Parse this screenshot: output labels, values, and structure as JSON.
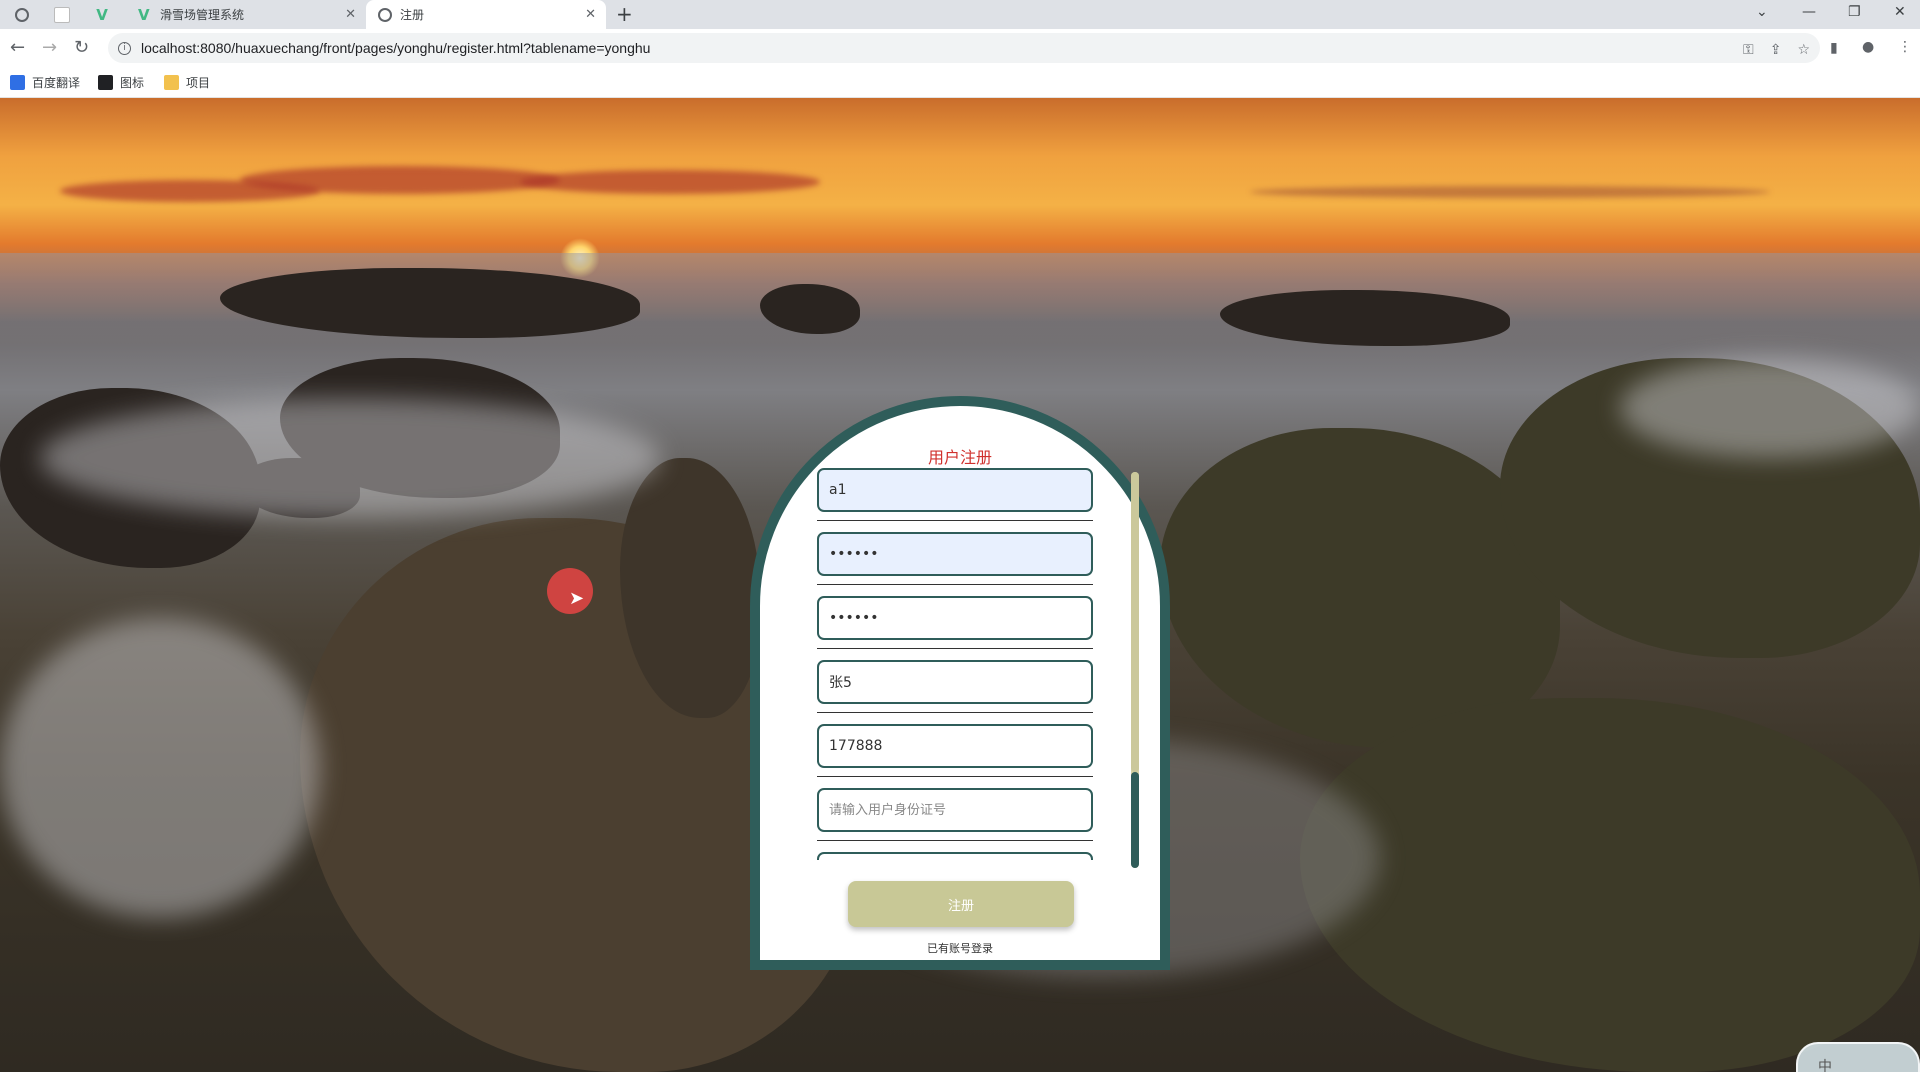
{
  "browser": {
    "tabs": [
      {
        "label": "",
        "icon": "globe-icon"
      },
      {
        "label": "",
        "icon": "blank-page-icon"
      },
      {
        "label": "",
        "icon": "vue-logo-icon"
      },
      {
        "label": "滑雪场管理系统",
        "icon": "vue-logo-icon"
      },
      {
        "label": "注册",
        "icon": "globe-icon"
      }
    ],
    "url": "localhost:8080/huaxuechang/front/pages/yonghu/register.html?tablename=yonghu",
    "bookmarks": [
      {
        "label": "百度翻译",
        "color": "#2f6fe4"
      },
      {
        "label": "图标",
        "color": "#202124"
      },
      {
        "label": "项目",
        "color": "#f2c14e"
      }
    ]
  },
  "form": {
    "title": "用户注册",
    "fields": [
      {
        "value": "a1",
        "placeholder": "",
        "type": "text",
        "autofilled": true
      },
      {
        "value": "••••••",
        "placeholder": "",
        "type": "text",
        "autofilled": true
      },
      {
        "value": "••••••",
        "placeholder": "",
        "type": "text",
        "autofilled": false
      },
      {
        "value": "张5",
        "placeholder": "",
        "type": "text",
        "autofilled": false
      },
      {
        "value": "177888",
        "placeholder": "",
        "type": "text",
        "autofilled": false
      },
      {
        "value": "",
        "placeholder": "请输入用户身份证号",
        "type": "text",
        "autofilled": false
      },
      {
        "value": "",
        "placeholder": "",
        "type": "text",
        "autofilled": false
      }
    ],
    "submit_label": "注册",
    "login_link": "已有账号登录"
  },
  "ime": {
    "label": "中"
  },
  "colors": {
    "accent": "#2f5d5a",
    "title": "#d0312d",
    "button": "#c8c896"
  }
}
